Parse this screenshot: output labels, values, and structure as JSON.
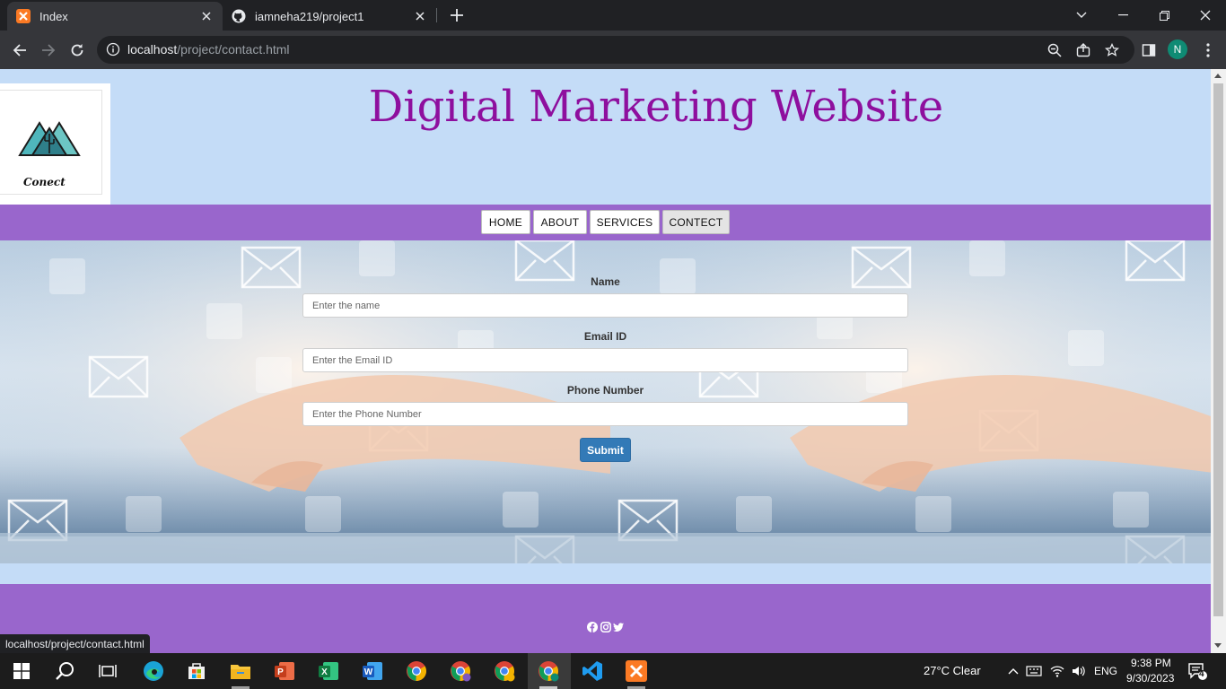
{
  "browser": {
    "tabs": [
      {
        "title": "Index",
        "active": true,
        "icon": "xampp-icon"
      },
      {
        "title": "iamneha219/project1",
        "active": false,
        "icon": "github-icon"
      }
    ],
    "url_host": "localhost",
    "url_path": "/project/contact.html",
    "profile_initial": "N",
    "status_url": "localhost/project/contact.html"
  },
  "page": {
    "logo_text": "Conect",
    "title": "Digital Marketing Website",
    "nav": [
      "HOME",
      "ABOUT",
      "SERVICES",
      "CONTECT"
    ],
    "active_nav": "CONTECT",
    "form": {
      "name_label": "Name",
      "name_placeholder": "Enter the name",
      "email_label": "Email ID",
      "email_placeholder": "Enter the Email ID",
      "phone_label": "Phone Number",
      "phone_placeholder": "Enter the Phone Number",
      "submit_label": "Submit"
    },
    "social_icons": [
      "facebook-icon",
      "instagram-icon",
      "twitter-icon"
    ],
    "colors": {
      "nav_bg": "#9966cc",
      "title": "#8e0f9e",
      "page_bg": "#c4dcf7",
      "submit": "#337ab7"
    }
  },
  "taskbar": {
    "weather": "27°C  Clear",
    "language": "ENG",
    "time": "9:38 PM",
    "date": "9/30/2023",
    "notifications": "4"
  }
}
